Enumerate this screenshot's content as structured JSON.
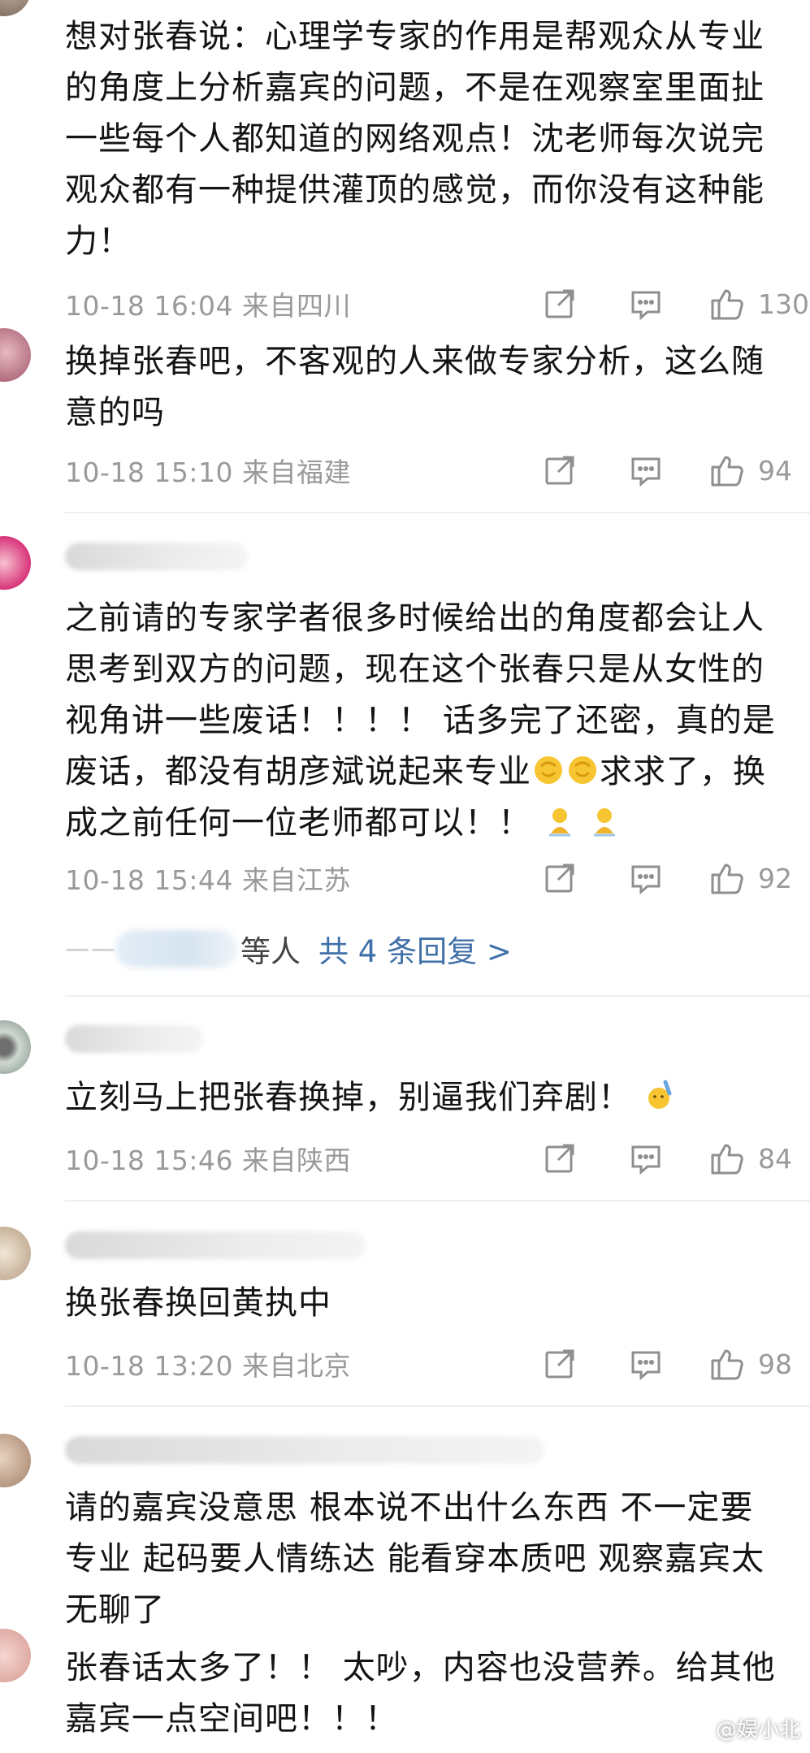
{
  "comments": [
    {
      "text": "想对张春说：心理学专家的作用是帮观众从专业的角度上分析嘉宾的问题，不是在观察室里面扯一些每个人都知道的网络观点！沈老师每次说完观众都有一种提供灌顶的感觉，而你没有这种能力！",
      "date": "10-18 16:04",
      "location": "来自四川",
      "likes": "130"
    },
    {
      "text": "换掉张春吧，不客观的人来做专家分析，这么随意的吗",
      "date": "10-18 15:10",
      "location": "来自福建",
      "likes": "94"
    },
    {
      "text_a": "之前请的专家学者很多时候给出的角度都会让人思考到双方的问题，现在这个张春只是从女性的视角讲一些废话！！！！ 话多完了还密，真的是废话，都没有胡彦斌说起来专业",
      "text_b": "求求了，换成之前任何一位老师都可以！！",
      "date": "10-18 15:44",
      "location": "来自江苏",
      "likes": "92",
      "reply_suffix": "等人",
      "reply_more": "共 4 条回复 >"
    },
    {
      "text": "立刻马上把张春换掉，别逼我们弃剧！",
      "date": "10-18 15:46",
      "location": "来自陕西",
      "likes": "84"
    },
    {
      "text": "换张春换回黄执中",
      "date": "10-18 13:20",
      "location": "来自北京",
      "likes": "98"
    },
    {
      "text": "请的嘉宾没意思 根本说不出什么东西 不一定要专业 起码要人情练达 能看穿本质吧 观察嘉宾太无聊了"
    },
    {
      "text": "张春话太多了！！ 太吵，内容也没营养。给其他嘉宾一点空间吧！！！"
    }
  ],
  "watermark": "@娱小北",
  "icons": {
    "share": "share-icon",
    "reply": "comment-icon",
    "like": "thumbs-up-icon"
  },
  "colors": {
    "meta_text": "#9a9a9a",
    "link": "#3f70a8",
    "divider": "#efefef"
  }
}
